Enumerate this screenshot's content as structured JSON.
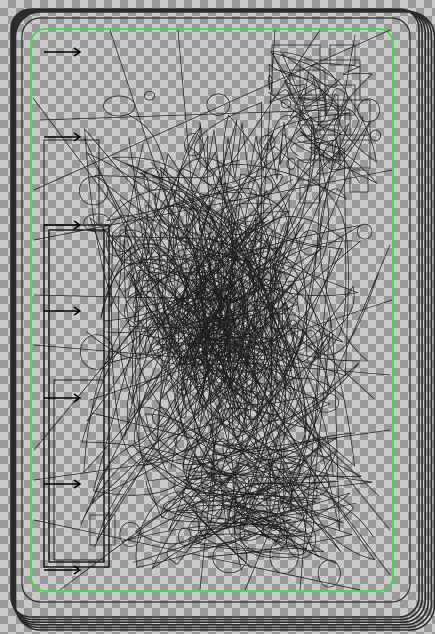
{
  "canvas": {
    "checker_light": "#c9c9c9",
    "checker_dark": "#9a9a9a",
    "frame_stroke": "#2b2b2b",
    "safe_area_stroke": "#39e04a",
    "sketch_stroke": "#1e1e1e",
    "arrow_stroke": "#000000"
  },
  "scene": {
    "description_icons": [
      "layered-card-frame",
      "safe-area-guide",
      "arrow-markers",
      "sketch-strokes"
    ],
    "arrow_marker_count": 7,
    "card_layers": 6
  }
}
